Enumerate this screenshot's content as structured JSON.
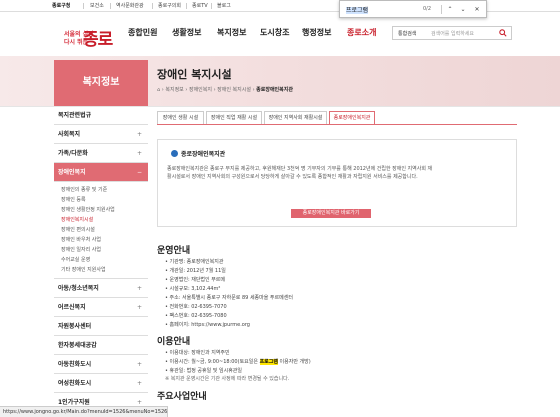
{
  "topbar": {
    "items": [
      "종로구청",
      "보건소",
      "역사문화관광",
      "종로구의회",
      "종로TV",
      "블로그"
    ],
    "active": 0
  },
  "logo": {
    "line1": "서울의 심장",
    "line2": "다시 뛰는",
    "name": "종로"
  },
  "gnb": {
    "items": [
      "종합민원",
      "생활정보",
      "복지정보",
      "도시창조",
      "행정정보",
      "종로소개"
    ],
    "highlight_index": 5
  },
  "search": {
    "select_label": "통합검색",
    "placeholder": "검색어를 입력하세요"
  },
  "find": {
    "query": "프로그램",
    "count": "0/2"
  },
  "lnb": {
    "title": "복지정보",
    "items": [
      {
        "label": "복지관련법규",
        "plus": ""
      },
      {
        "label": "사회복지",
        "plus": "+"
      },
      {
        "label": "가족/다문화",
        "plus": "+"
      },
      {
        "label": "장애인복지",
        "plus": "−",
        "active": true
      },
      {
        "label": "아동/청소년복지",
        "plus": "+"
      },
      {
        "label": "어르신복지",
        "plus": "+"
      },
      {
        "label": "자원봉사센터",
        "plus": ""
      },
      {
        "label": "한자봉세대공감",
        "plus": ""
      },
      {
        "label": "아동친화도시",
        "plus": "+"
      },
      {
        "label": "여성친화도시",
        "plus": "+"
      },
      {
        "label": "1인가구지원",
        "plus": "+"
      }
    ],
    "subitems": [
      "장애인의 종류 및 기준",
      "장애인 등록",
      "장애인 생활안정 지원사업",
      "장애인복지시설",
      "장애인 편의시설",
      "장애인 바우처 사업",
      "장애인 일자리 사업",
      "수어교실 운영",
      "기타 장애인 지원사업"
    ],
    "sub_active": 3
  },
  "page": {
    "title": "장애인 복지시설",
    "breadcrumb": [
      "복지정보",
      "장애인복지",
      "장애인 복지시설",
      "종로장애인복지관"
    ]
  },
  "tabs": [
    "장애인 생활 시설",
    "장애인 직업 재활 시설",
    "장애인 지역사회 재활시설",
    "종로장애인복지관"
  ],
  "tab_active": 3,
  "facility": {
    "name": "종로장애인복지관",
    "desc": "종로장애인복지관은 종로구 부지를 제공하고, 후원해재단 3천억 명 기부자의 기부를 통해 2012년에 건립한 장애인 지역사회 재활시설로서 장애인 지역사회의 구성원으로서 당당하게 살아갈 수 있도록 종합적인 재활과 자립지원 서비스를 제공합니다.",
    "button": "종로장애인복지관 바로가기"
  },
  "operation": {
    "heading": "운영안내",
    "items": [
      "기관명: 종로장애인복지관",
      "개관일: 2012년 7월 11일",
      "운영법인: 재단법인 푸르메",
      "시설규모: 3,102.44m²",
      "주소: 서울특별시 종로구 자하문로 89 세종마을 푸르메센터",
      "전화번호: 02-6395-7070",
      "팩스번호: 02-6395-7080",
      "홈페이지: https://www.jpurme.org"
    ]
  },
  "usage": {
    "heading": "이용안내",
    "items": [
      {
        "pre": "이용대상: 장애인과 지역주민",
        "hl": "",
        "post": ""
      },
      {
        "pre": "이용시간: 월~금, 9:00~18:00(토요일은 ",
        "hl": "프로그램",
        "post": " 이용자만 개방)"
      },
      {
        "pre": "휴관일: 법정 공휴일 및 임시휴관일",
        "hl": "",
        "post": ""
      }
    ],
    "note": "※ 복지관 운영시간은 기관 사정에 따라 변경될 수 있습니다."
  },
  "main_project": {
    "heading": "주요사업안내"
  },
  "status_url": "https://www.jongno.go.kr/Main.do?menuId=1526&menuNo=1526"
}
